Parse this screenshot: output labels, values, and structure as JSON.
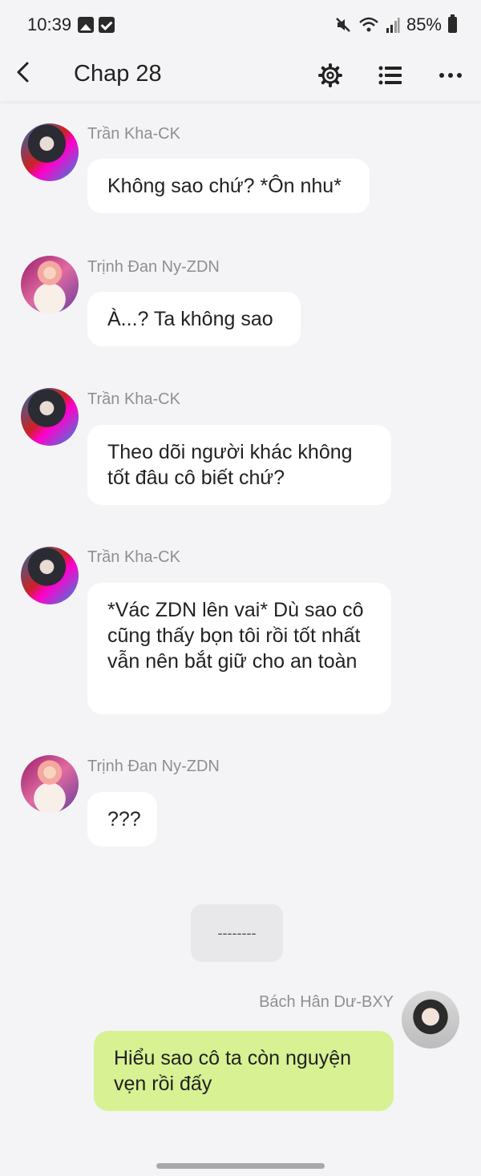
{
  "status_bar": {
    "time": "10:39",
    "battery_percent": "85%"
  },
  "app_bar": {
    "title": "Chap 28"
  },
  "messages": [
    {
      "sender": "Trần Kha-CK",
      "text": "Không sao chứ? *Ôn nhu*",
      "side": "left"
    },
    {
      "sender": "Trịnh Đan Ny-ZDN",
      "text": "À...? Ta không sao",
      "side": "left"
    },
    {
      "sender": "Trần Kha-CK",
      "text": "Theo dõi người khác không tốt đâu cô biết chứ?",
      "side": "left"
    },
    {
      "sender": "Trần Kha-CK",
      "text": "*Vác ZDN lên vai* Dù sao cô cũng thấy bọn tôi rồi tốt nhất vẫn nên bắt giữ cho an toàn",
      "side": "left"
    },
    {
      "sender": "Trịnh Đan Ny-ZDN",
      "text": "???",
      "side": "left"
    },
    {
      "sender": "Bách Hân Dư-BXY",
      "text": "Hiểu sao cô ta còn nguyện vẹn rồi đấy",
      "side": "right"
    }
  ],
  "divider_text": "--------",
  "colors": {
    "background": "#f4f4f6",
    "bubble_incoming": "#ffffff",
    "bubble_outgoing": "#d7f193",
    "sender_name": "#8f8f93"
  },
  "icons": [
    "back-arrow-icon",
    "settings-gear-icon",
    "list-icon",
    "more-dots-icon"
  ]
}
